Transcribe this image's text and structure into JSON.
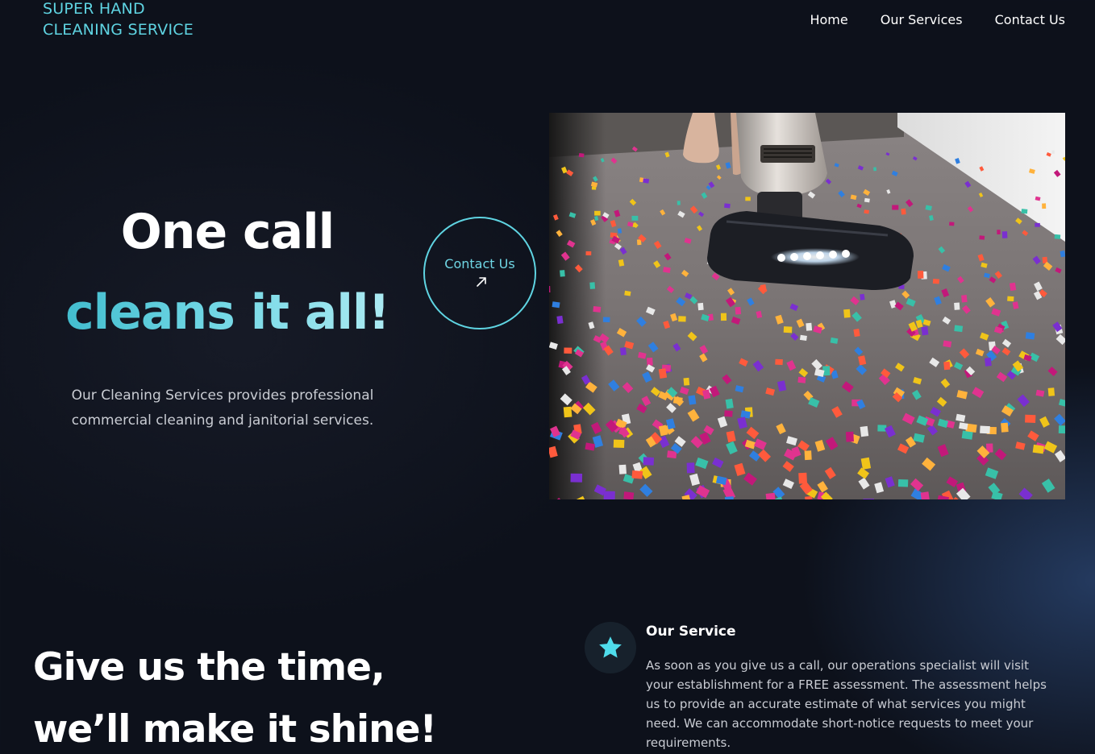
{
  "brand": {
    "line1": "SUPER HAND",
    "line2": "CLEANING SERVICE",
    "accent_color": "#5fd4e2"
  },
  "nav": {
    "items": [
      {
        "label": "Home"
      },
      {
        "label": "Our Services"
      },
      {
        "label": "Contact Us"
      }
    ]
  },
  "hero": {
    "headline_line1": "One call",
    "headline_line2": "cleans it all!",
    "description": "Our Cleaning Services provides professional commercial cleaning and janitorial services.",
    "cta_label": "Contact Us",
    "cta_icon": "arrow-up-right-icon",
    "image_icon": "vacuum-carpet-confetti-photo"
  },
  "tagline": {
    "line1": "Give us the time,",
    "line2": "we’ll make it shine!"
  },
  "service": {
    "icon": "star-icon",
    "title": "Our Service",
    "body": "As soon as you give us a call, our operations specialist will visit your establishment for a FREE assessment. The assessment helps us to provide an accurate estimate of what services you might need. We can accommodate short-notice requests to meet your requirements."
  },
  "colors": {
    "background": "#0d111b",
    "text": "#ffffff",
    "muted_text": "#c9ccd3",
    "accent": "#5fd4e2"
  }
}
